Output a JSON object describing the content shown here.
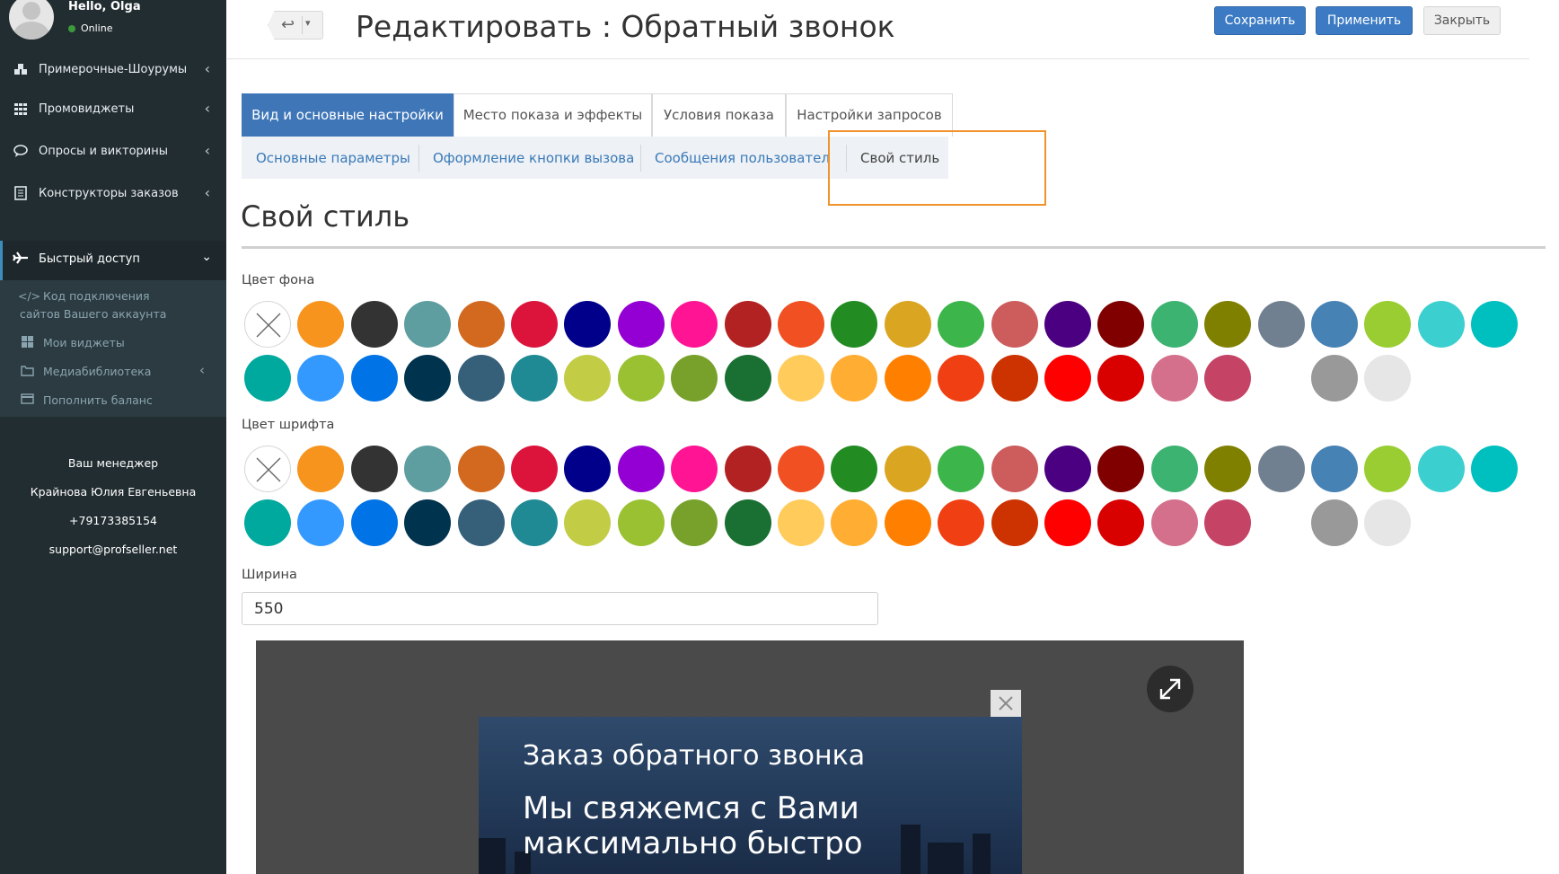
{
  "user": {
    "greeting": "Hello, Olga",
    "status": "Online"
  },
  "sidebar": {
    "items": [
      {
        "label": "Примерочные-Шоурумы",
        "icon": "cubes-icon"
      },
      {
        "label": "Промовиджеты",
        "icon": "grid-icon"
      },
      {
        "label": "Опросы и викторины",
        "icon": "chat-icon"
      },
      {
        "label": "Конструкторы заказов",
        "icon": "document-icon"
      },
      {
        "label": "Быстрый доступ",
        "icon": "plane-icon"
      }
    ],
    "subitems": [
      {
        "label_line1": "Код подключения",
        "label_line2": "сайтов Вашего аккаунта",
        "icon": "code-icon"
      },
      {
        "label": "Мои виджеты",
        "icon": "widgets-icon"
      },
      {
        "label": "Медиабиблиотека",
        "icon": "folder-icon"
      },
      {
        "label": "Пополнить баланс",
        "icon": "card-icon"
      }
    ],
    "manager": {
      "title": "Ваш менеджер",
      "name": "Крайнова Юлия Евгеньевна",
      "phone": "+79173385154",
      "email": "support@profseller.net"
    }
  },
  "header": {
    "title": "Редактировать : Обратный звонок",
    "save_label": "Сохранить",
    "apply_label": "Применить",
    "close_label": "Закрыть"
  },
  "tabs": [
    {
      "label": "Вид и основные настройки",
      "active": true
    },
    {
      "label": "Место показа и эффекты",
      "active": false
    },
    {
      "label": "Условия показа",
      "active": false
    },
    {
      "label": "Настройки запросов",
      "active": false
    }
  ],
  "subtabs": [
    {
      "label": "Основные параметры",
      "active": false
    },
    {
      "label": "Оформление кнопки вызова",
      "active": false
    },
    {
      "label": "Сообщения пользователю",
      "active": false
    },
    {
      "label": "Свой стиль",
      "active": true
    }
  ],
  "section": {
    "title": "Свой стиль",
    "bg_color_label": "Цвет фона",
    "font_color_label": "Цвет шрифта",
    "width_label": "Ширина",
    "width_value": "550"
  },
  "palette": {
    "row1": [
      "none",
      "#f7941d",
      "#333333",
      "#5f9ea0",
      "#d2691e",
      "#dc143c",
      "#00008b",
      "#9400d3",
      "#ff1493",
      "#b22222",
      "#f05022",
      "#228b22",
      "#daa520",
      "#3cb54a",
      "#cd5c5c",
      "#4b0082",
      "#800000",
      "#3cb371",
      "#808000",
      "#708090",
      "#4682b4",
      "#9acd32",
      "#3ccfcf",
      "#00bfbf"
    ],
    "row2": [
      "#00a99d",
      "#3399ff",
      "#0073e6",
      "#00334d",
      "#365f7a",
      "#1f8a94",
      "#c2cc45",
      "#99c132",
      "#77a12a",
      "#1a7032",
      "#ffcc5c",
      "#ffad33",
      "#ff8000",
      "#f04013",
      "#cc3300",
      "#ff0000",
      "#d90000",
      "#d4708c",
      "#c54466",
      "",
      "#999999",
      "#e6e6e6"
    ]
  },
  "preview": {
    "title": "Заказ обратного звонка",
    "text": "Мы свяжемся с Вами максимально быстро"
  },
  "colors": {
    "sidebar": "#222d32",
    "primary": "#3c7bc4",
    "highlight": "#f0932b"
  }
}
